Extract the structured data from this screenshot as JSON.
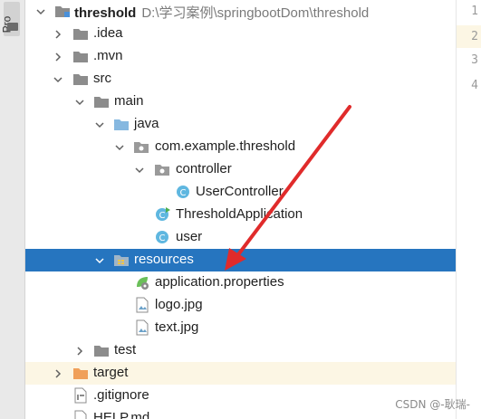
{
  "sidebar": {
    "tab_label": "Pro"
  },
  "tree": {
    "root": {
      "label": "threshold",
      "path": "D:\\学习案例\\springbootDom\\threshold"
    },
    "items": [
      {
        "label": ".idea"
      },
      {
        "label": ".mvn"
      },
      {
        "label": "src"
      },
      {
        "label": "main"
      },
      {
        "label": "java"
      },
      {
        "label": "com.example.threshold"
      },
      {
        "label": "controller"
      },
      {
        "label": "UserController"
      },
      {
        "label": "ThresholdApplication"
      },
      {
        "label": "user"
      },
      {
        "label": "resources"
      },
      {
        "label": "application.properties"
      },
      {
        "label": "logo.jpg"
      },
      {
        "label": "text.jpg"
      },
      {
        "label": "test"
      },
      {
        "label": "target"
      },
      {
        "label": ".gitignore"
      },
      {
        "label": "HELP.md"
      }
    ]
  },
  "gutter": {
    "line_numbers": [
      "1",
      "2",
      "3",
      "4"
    ]
  },
  "watermark": "CSDN @-耿瑞-",
  "colors": {
    "selection": "#2675bf",
    "folder": "#8c8c8c",
    "source_folder": "#86b8e0",
    "excluded_folder": "#f0a05a",
    "annotation_arrow": "#e02b2b"
  }
}
